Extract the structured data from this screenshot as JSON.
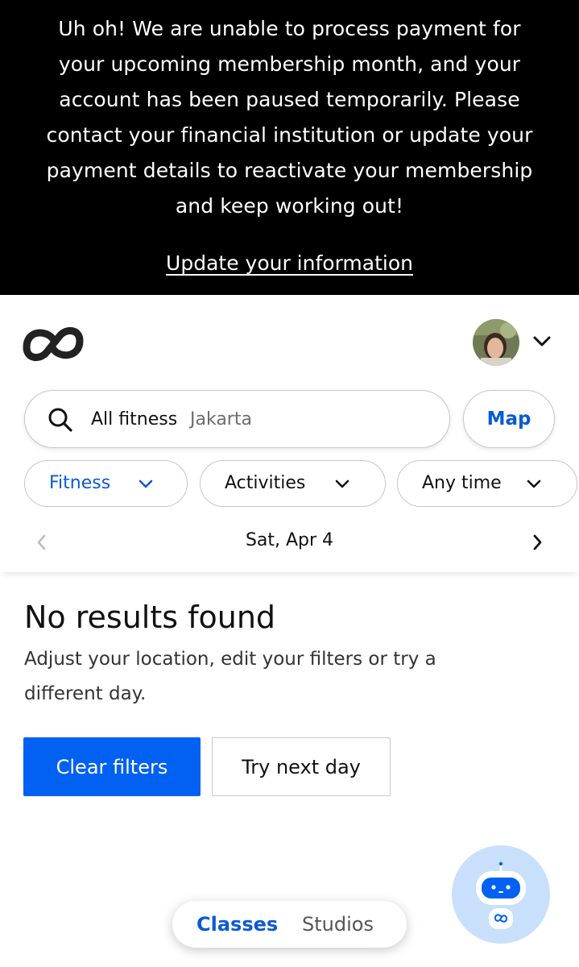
{
  "banner": {
    "message": "Uh oh! We are unable to process payment for your upcoming membership month, and your account has been paused temporarily. Please contact your financial institution or update your payment details to reactivate your membership and keep working out!",
    "link_label": "Update your information"
  },
  "header": {
    "logo_icon": "classpass-logo-icon",
    "avatar_icon": "user-avatar",
    "account_menu_icon": "chevron-down-icon"
  },
  "search": {
    "activity": "All fitness",
    "location": "Jakarta",
    "icon": "search-icon",
    "map_label": "Map"
  },
  "filters": [
    {
      "label": "Fitness",
      "active": true
    },
    {
      "label": "Activities",
      "active": false
    },
    {
      "label": "Any time",
      "active": false
    }
  ],
  "date_nav": {
    "label": "Sat, Apr 4",
    "prev_icon": "chevron-left-icon",
    "next_icon": "chevron-right-icon"
  },
  "results": {
    "title": "No results found",
    "description": "Adjust your location, edit your filters or try a different day.",
    "clear_label": "Clear filters",
    "next_day_label": "Try next day"
  },
  "bottom_tabs": [
    {
      "label": "Classes",
      "active": true
    },
    {
      "label": "Studios",
      "active": false
    }
  ],
  "assistant": {
    "icon": "robot-assistant-icon"
  },
  "colors": {
    "accent": "#0a5ad4",
    "primary_button": "#0061f2",
    "banner_bg": "#000000",
    "assistant_bg": "#c8e0fb"
  }
}
